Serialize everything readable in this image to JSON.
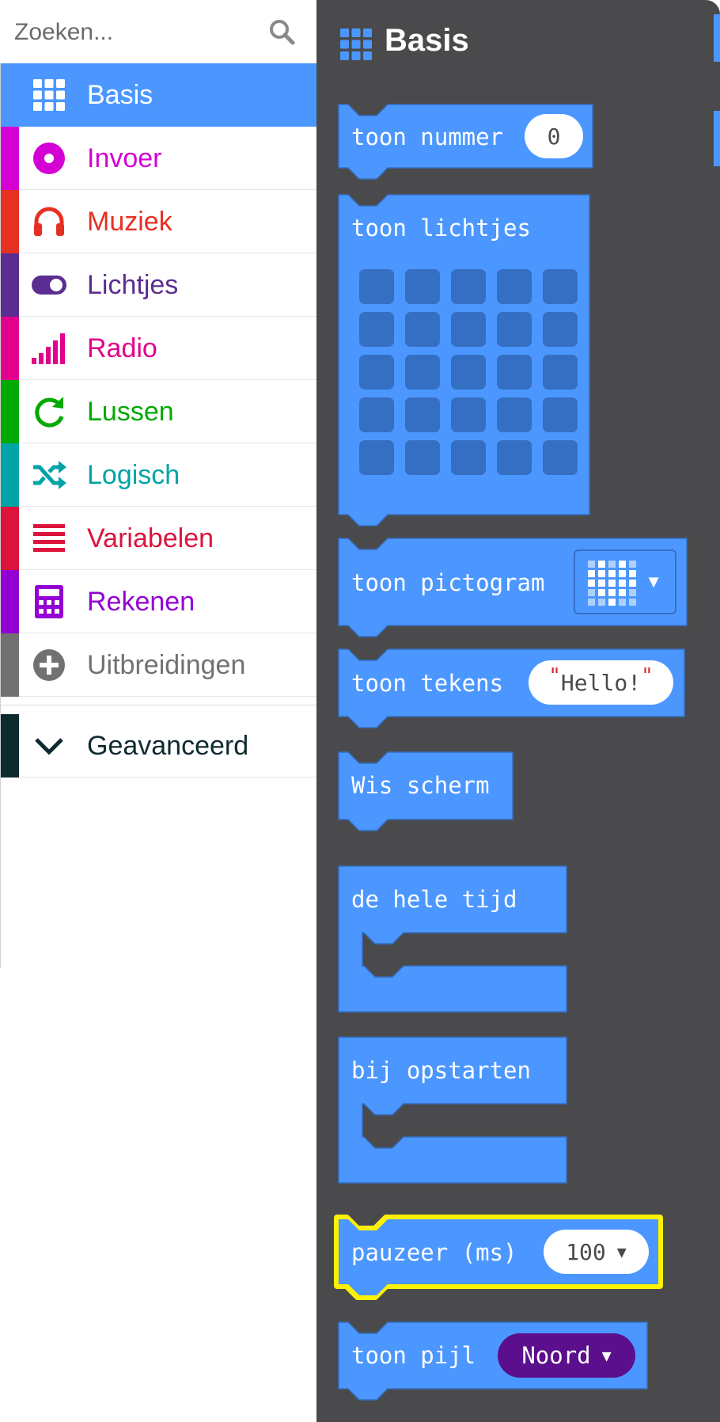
{
  "search": {
    "placeholder": "Zoeken..."
  },
  "categories": [
    {
      "label": "Basis",
      "color": "#4c97ff",
      "icon": "grid-icon",
      "selected": true
    },
    {
      "label": "Invoer",
      "color": "#d400d4",
      "icon": "target-icon"
    },
    {
      "label": "Muziek",
      "color": "#e63022",
      "icon": "headphones-icon"
    },
    {
      "label": "Lichtjes",
      "color": "#5c2d91",
      "icon": "toggle-icon"
    },
    {
      "label": "Radio",
      "color": "#e3008c",
      "icon": "signal-bars-icon"
    },
    {
      "label": "Lussen",
      "color": "#00aa00",
      "icon": "refresh-icon"
    },
    {
      "label": "Logisch",
      "color": "#00a4a6",
      "icon": "shuffle-icon"
    },
    {
      "label": "Variabelen",
      "color": "#dc143c",
      "icon": "list-lines-icon"
    },
    {
      "label": "Rekenen",
      "color": "#9400d3",
      "icon": "calculator-icon"
    },
    {
      "label": "Uitbreidingen",
      "color": "#717171",
      "icon": "plus-circle-icon"
    },
    {
      "label": "Geavanceerd",
      "color": "#0d2a2f",
      "icon": "chevron-down-icon"
    }
  ],
  "flyout": {
    "title": "Basis",
    "blocks": {
      "show_number": {
        "label": "toon nummer",
        "value": "0"
      },
      "show_leds": {
        "label": "toon lichtjes"
      },
      "show_icon": {
        "label": "toon pictogram"
      },
      "show_string": {
        "label": "toon tekens",
        "value": "Hello!"
      },
      "clear_screen": {
        "label": "Wis scherm"
      },
      "forever": {
        "label": "de hele tijd"
      },
      "on_start": {
        "label": "bij opstarten"
      },
      "pause": {
        "label": "pauzeer (ms)",
        "value": "100"
      },
      "show_arrow": {
        "label": "toon pijl",
        "value": "Noord"
      }
    }
  },
  "colors": {
    "block": "#4c97ff",
    "block_dark": "#346fc4",
    "flyout_bg": "#4a4a4c",
    "highlight": "#fff200",
    "arrow_dropdown": "#5b0f8c"
  }
}
